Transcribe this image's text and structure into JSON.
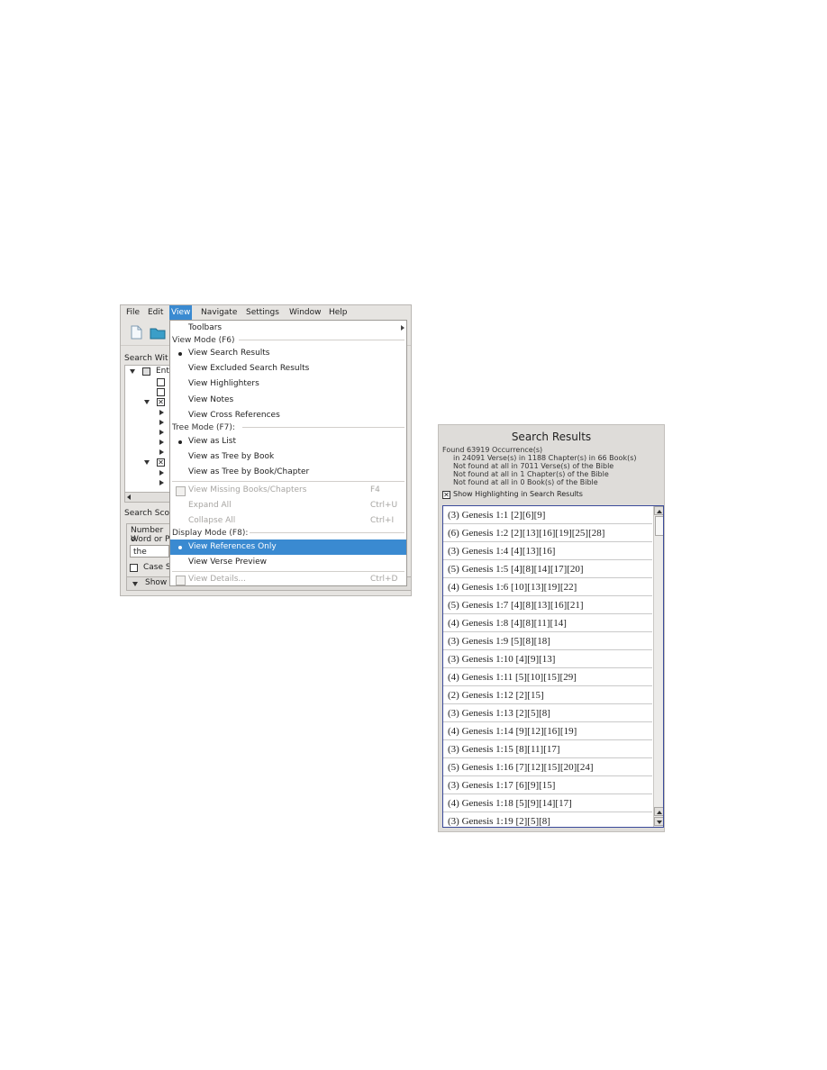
{
  "menubar": {
    "items": [
      {
        "label": "File"
      },
      {
        "label": "Edit"
      },
      {
        "label": "View"
      },
      {
        "label": "Navigate"
      },
      {
        "label": "Settings"
      },
      {
        "label": "Window"
      },
      {
        "label": "Help"
      }
    ]
  },
  "left_panel": {
    "search_within_label": "Search Wit",
    "tree_root_label": "Ent",
    "search_scope_label": "Search Sco",
    "number_label": "Number o",
    "word_label": "Word or P",
    "search_value": "the",
    "case_label": "Case S",
    "show_label": "Show"
  },
  "view_menu": {
    "toolbars": "Toolbars",
    "view_mode_header": "View Mode (F6)",
    "view_search_results": "View Search Results",
    "view_excluded": "View Excluded Search Results",
    "view_highlighters": "View Highlighters",
    "view_notes": "View Notes",
    "view_cross_refs": "View Cross References",
    "tree_mode_header": "Tree Mode (F7):",
    "view_as_list": "View as List",
    "view_tree_book": "View as Tree by Book",
    "view_tree_book_chapter": "View as Tree by Book/Chapter",
    "view_missing": "View Missing Books/Chapters",
    "view_missing_shortcut": "F4",
    "expand_all": "Expand All",
    "expand_all_shortcut": "Ctrl+U",
    "collapse_all": "Collapse All",
    "collapse_all_shortcut": "Ctrl+I",
    "display_mode_header": "Display Mode (F8):",
    "view_refs_only": "View References Only",
    "view_verse_preview": "View Verse Preview",
    "view_details": "View Details...",
    "view_details_shortcut": "Ctrl+D"
  },
  "search_results": {
    "title": "Search Results",
    "stats": [
      "Found 63919 Occurrence(s)",
      "in 24091 Verse(s) in 1188 Chapter(s) in 66 Book(s)",
      "Not found at all in 7011 Verse(s) of the Bible",
      "Not found at all in 1 Chapter(s) of the Bible",
      "Not found at all in 0 Book(s) of the Bible"
    ],
    "highlight_label": "Show Highlighting in Search Results",
    "rows": [
      "(3) Genesis 1:1 [2][6][9]",
      "(6) Genesis 1:2 [2][13][16][19][25][28]",
      "(3) Genesis 1:4 [4][13][16]",
      "(5) Genesis 1:5 [4][8][14][17][20]",
      "(4) Genesis 1:6 [10][13][19][22]",
      "(5) Genesis 1:7 [4][8][13][16][21]",
      "(4) Genesis 1:8 [4][8][11][14]",
      "(3) Genesis 1:9 [5][8][18]",
      "(3) Genesis 1:10 [4][9][13]",
      "(4) Genesis 1:11 [5][10][15][29]",
      "(2) Genesis 1:12 [2][15]",
      "(3) Genesis 1:13 [2][5][8]",
      "(4) Genesis 1:14 [9][12][16][19]",
      "(3) Genesis 1:15 [8][11][17]",
      "(5) Genesis 1:16 [7][12][15][20][24]",
      "(3) Genesis 1:17 [6][9][15]",
      "(4) Genesis 1:18 [5][9][14][17]",
      "(3) Genesis 1:19 [2][5][8]"
    ]
  }
}
